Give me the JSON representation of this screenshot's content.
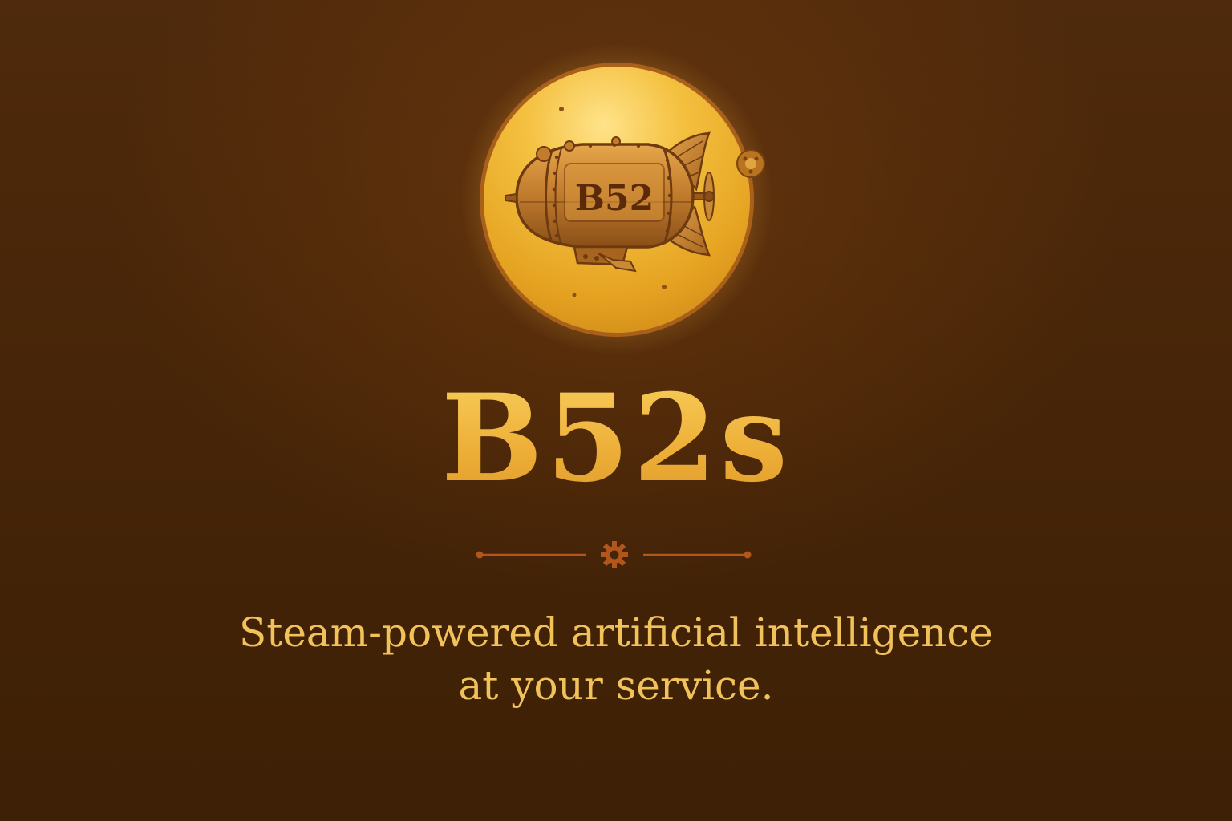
{
  "brand": {
    "emblem_label": "B52",
    "title": "B52s"
  },
  "tagline": {
    "line1": "Steam-powered artificial intelligence",
    "line2": "at your service."
  },
  "colors": {
    "background_top": "#4f2a0c",
    "background_bottom": "#3d2006",
    "gold": "#f0b33c",
    "emblem_rim": "#b56a1c",
    "ornament": "#b2561b"
  },
  "icons": {
    "emblem": "airship-icon",
    "divider_center": "gear-icon"
  }
}
